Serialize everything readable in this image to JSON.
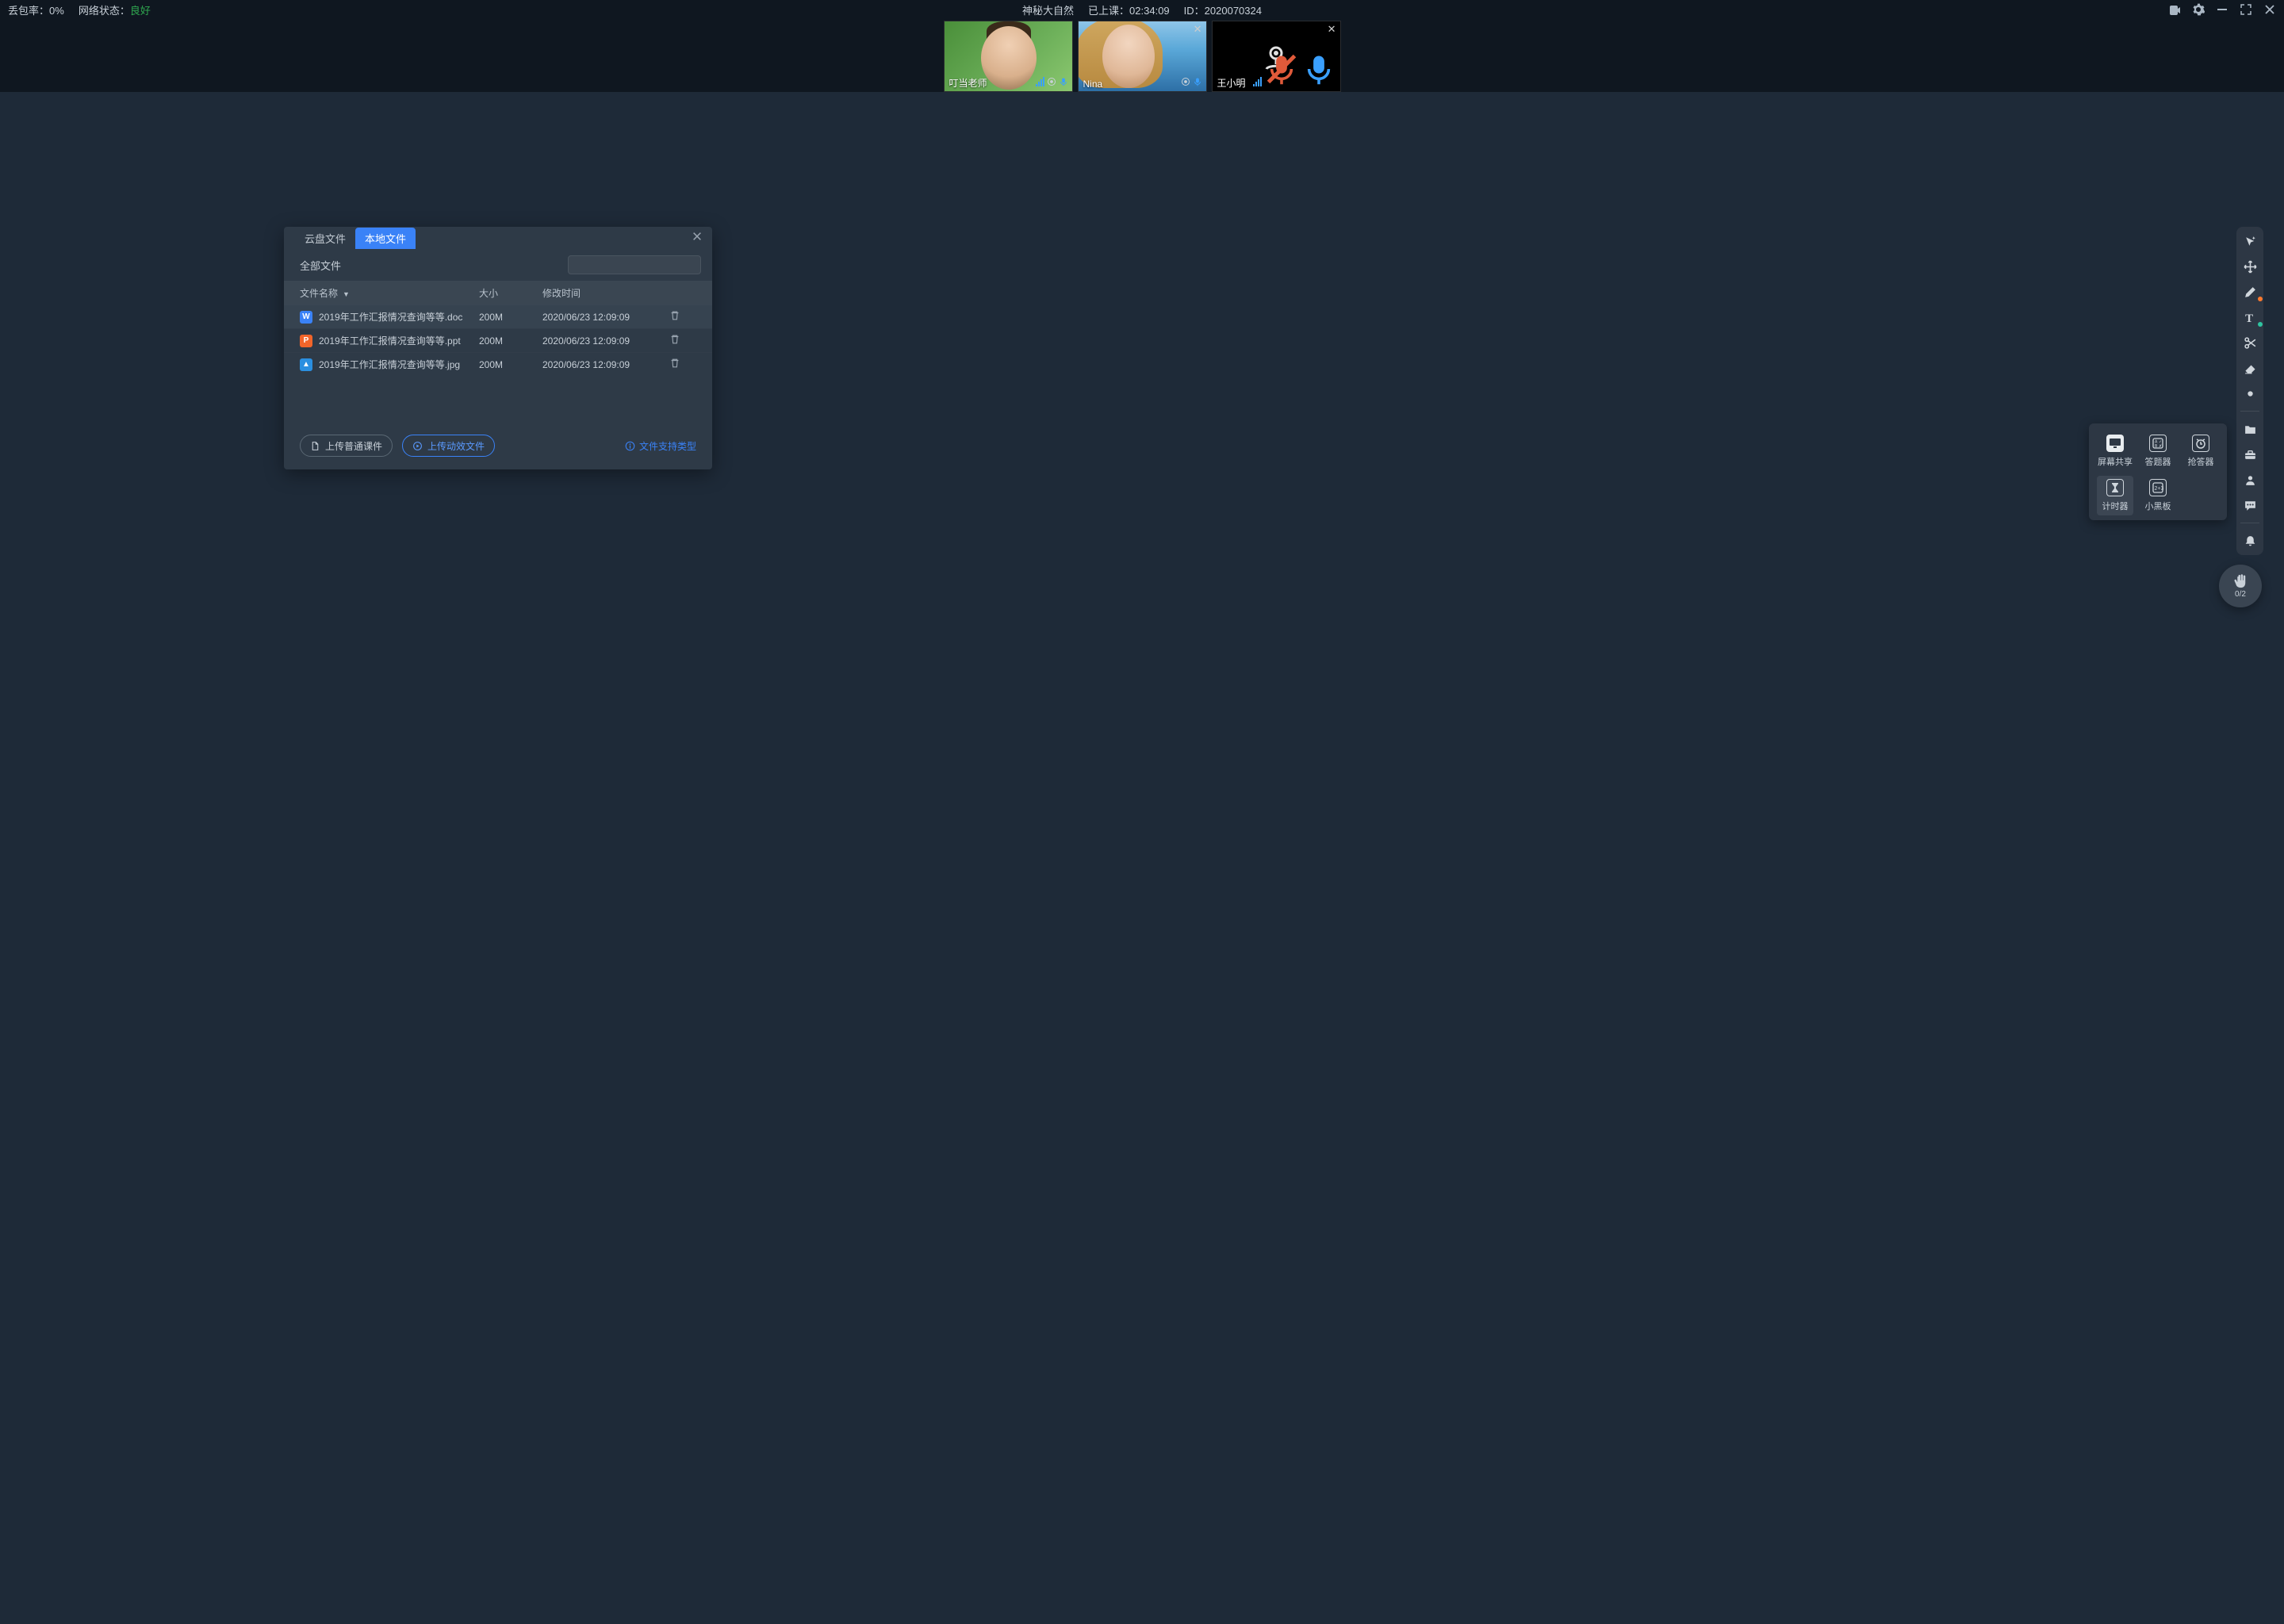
{
  "header": {
    "packet_loss_label": "丢包率：",
    "packet_loss_value": "0%",
    "network_label": "网络状态：",
    "network_value": "良好",
    "course_title": "神秘大自然",
    "elapsed_label": "已上课：",
    "elapsed_value": "02:34:09",
    "id_label": "ID：",
    "id_value": "2020070324"
  },
  "videos": [
    {
      "name": "叮当老师",
      "camera": "on",
      "style": "green",
      "mic_muted": false,
      "closable": false
    },
    {
      "name": "Nina",
      "camera": "on",
      "style": "sea",
      "mic_muted": false,
      "closable": true
    },
    {
      "name": "王小明",
      "camera": "off",
      "style": "off",
      "mic_muted": true,
      "closable": true
    }
  ],
  "dialog": {
    "tabs": {
      "cloud": "云盘文件",
      "local": "本地文件",
      "active": "local"
    },
    "category_label": "全部文件",
    "columns": {
      "name": "文件名称",
      "size": "大小",
      "modified": "修改时间"
    },
    "files": [
      {
        "icon": "doc",
        "icon_letter": "W",
        "name": "2019年工作汇报情况查询等等.doc",
        "size": "200M",
        "modified": "2020/06/23 12:09:09",
        "selected": true
      },
      {
        "icon": "ppt",
        "icon_letter": "P",
        "name": "2019年工作汇报情况查询等等.ppt",
        "size": "200M",
        "modified": "2020/06/23 12:09:09",
        "selected": false
      },
      {
        "icon": "img",
        "icon_letter": "▲",
        "name": "2019年工作汇报情况查询等等.jpg",
        "size": "200M",
        "modified": "2020/06/23 12:09:09",
        "selected": false
      }
    ],
    "upload_normal": "上传普通课件",
    "upload_animated": "上传动效文件",
    "supported_types": "文件支持类型"
  },
  "tool_pop": {
    "items": [
      {
        "key": "screen-share",
        "label": "屏幕共享",
        "svg": "monitor"
      },
      {
        "key": "answer-card",
        "label": "答题器",
        "svg": "quiz"
      },
      {
        "key": "buzzer",
        "label": "抢答器",
        "svg": "alarm"
      },
      {
        "key": "timer",
        "label": "计时器",
        "svg": "hourglass",
        "active": true
      },
      {
        "key": "blackboard",
        "label": "小黑板",
        "svg": "formula"
      }
    ]
  },
  "right_toolbar": {
    "items": [
      {
        "key": "laser",
        "svg": "cursor-sparkle"
      },
      {
        "key": "move",
        "svg": "move"
      },
      {
        "key": "pen",
        "svg": "pen",
        "dot": "orange"
      },
      {
        "key": "text",
        "svg": "text",
        "dot": "teal"
      },
      {
        "key": "scissors",
        "svg": "scissors"
      },
      {
        "key": "eraser",
        "svg": "eraser"
      },
      {
        "key": "dot-tool",
        "svg": "dot"
      },
      {
        "key": "sep1",
        "sep": true
      },
      {
        "key": "folder",
        "svg": "folder"
      },
      {
        "key": "toolbox",
        "svg": "toolbox"
      },
      {
        "key": "person",
        "svg": "person"
      },
      {
        "key": "chat",
        "svg": "chat"
      },
      {
        "key": "sep2",
        "sep": true
      },
      {
        "key": "bell",
        "svg": "bell"
      }
    ]
  },
  "raise_hand": {
    "count": "0/2"
  }
}
